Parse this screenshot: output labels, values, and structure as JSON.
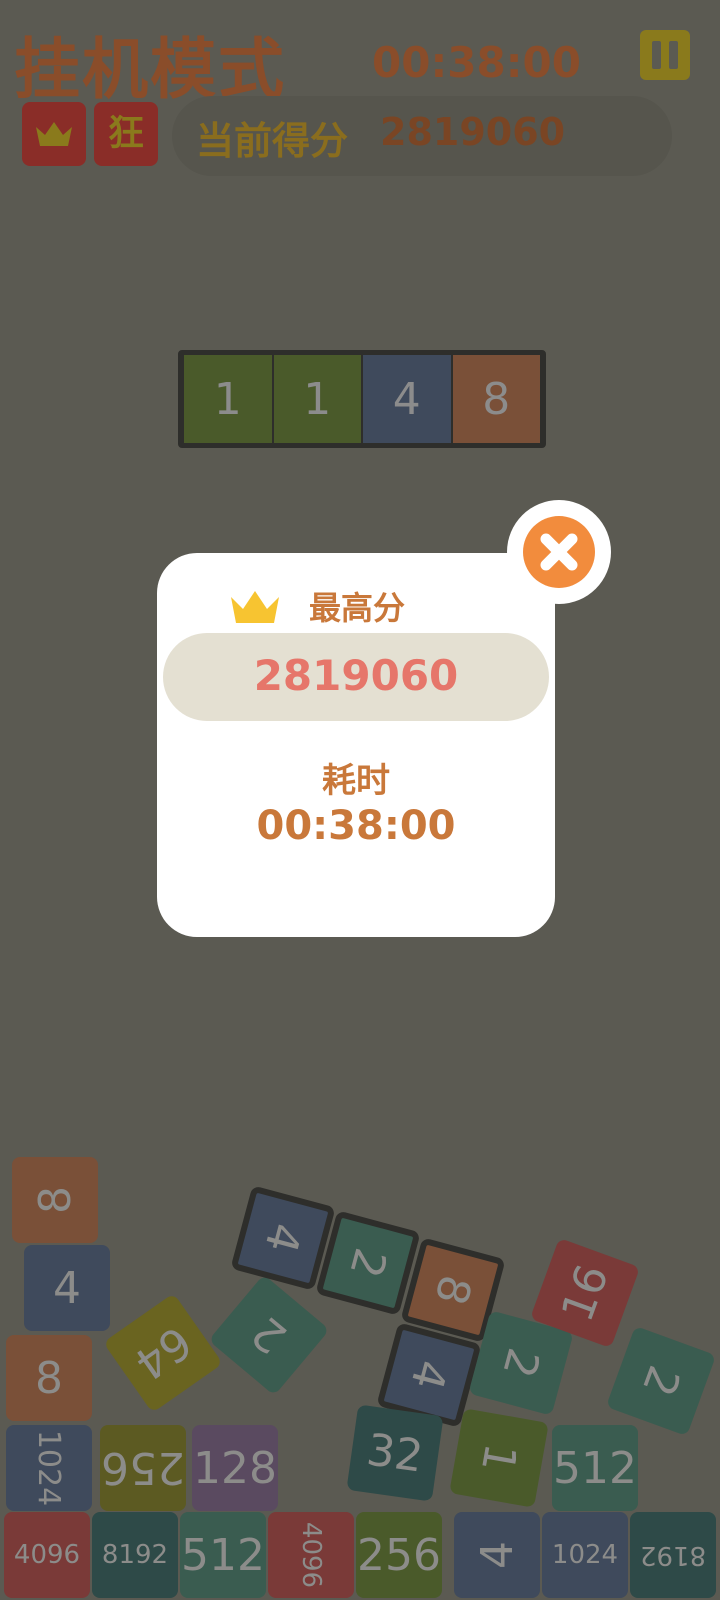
{
  "header": {
    "title": "挂机模式",
    "timer": "00:38:00",
    "badge_crazy": "狂",
    "score_label": "当前得分",
    "score_value": "2819060"
  },
  "preview": {
    "cells": [
      "1",
      "1",
      "4",
      "8"
    ]
  },
  "modal": {
    "best_label": "最高分",
    "best_value": "2819060",
    "time_label": "耗时",
    "time_value": "00:38:00"
  },
  "board": {
    "tiles": [
      "8",
      "4",
      "8",
      "64",
      "2",
      "4",
      "2",
      "8",
      "4",
      "2",
      "16",
      "2",
      "1024",
      "256",
      "128",
      "32",
      "1",
      "512",
      "4096",
      "8192",
      "512",
      "4096",
      "256",
      "4",
      "1024",
      "8192"
    ]
  },
  "colors": {
    "overlay_bg": "#5b5a52",
    "accent_orange": "#f28c3d",
    "score_red": "#e6766a",
    "label_orange": "#c9783a"
  }
}
